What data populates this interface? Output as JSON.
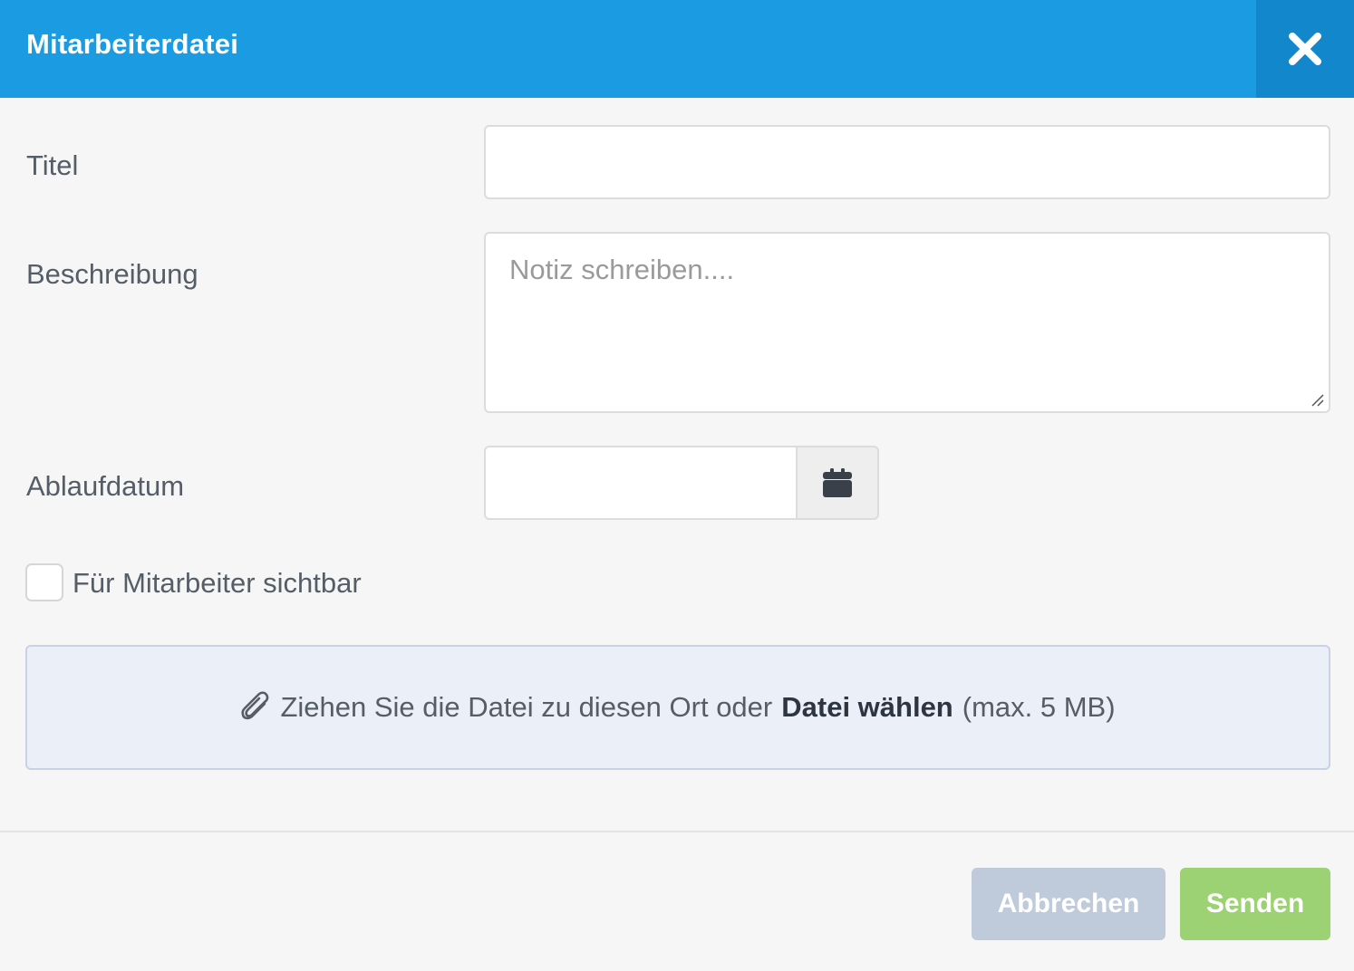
{
  "dialog": {
    "title": "Mitarbeiterdatei",
    "close_icon": "close-icon"
  },
  "form": {
    "title_label": "Titel",
    "title_value": "",
    "description_label": "Beschreibung",
    "description_placeholder": "Notiz schreiben....",
    "expiry_label": "Ablaufdatum",
    "expiry_value": "",
    "calendar_icon": "calendar-icon",
    "visible_checkbox_label": "Für Mitarbeiter sichtbar",
    "visible_checked": false
  },
  "dropzone": {
    "icon": "paperclip-icon",
    "text_before": "Ziehen Sie die Datei zu diesen Ort oder",
    "choose_label": "Datei wählen",
    "text_after": "(max. 5 MB)"
  },
  "footer": {
    "cancel_label": "Abbrechen",
    "send_label": "Senden"
  },
  "colors": {
    "header": "#1b9be1",
    "close_bg": "#1287cc",
    "cancel": "#bfcadb",
    "send": "#9cd174",
    "dropzone_bg": "#eaeff8"
  }
}
